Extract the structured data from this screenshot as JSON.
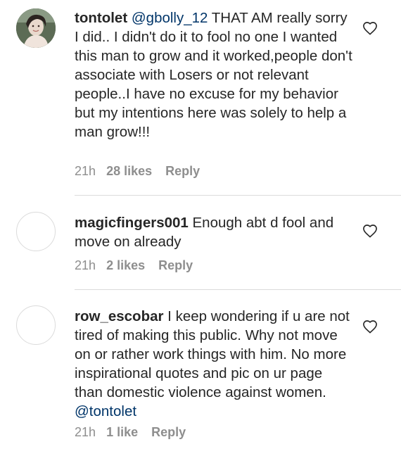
{
  "comments": [
    {
      "username": "tontolet",
      "mention": "@gbolly_12",
      "text": " THAT AM really sorry I did.. I didn't do it to fool no one I wanted this man to grow and it worked,people don't associate with Losers or not relevant people..I have no excuse for my behavior but my intentions here was solely to help a man grow!!!",
      "time": "21h",
      "likes": "28 likes",
      "reply": "Reply",
      "avatar": "profile-photo"
    },
    {
      "username": "magicfingers001",
      "text": " Enough abt d fool and move on already",
      "time": "21h",
      "likes": "2 likes",
      "reply": "Reply",
      "avatar": "empty"
    },
    {
      "username": "row_escobar",
      "text": " I keep wondering if u are not tired of making this public.  Why not move on or rather work things with him. No more inspirational quotes and pic on  ur page than domestic violence against  women. ",
      "mention": "@tontolet",
      "time": "21h",
      "likes": "1 like",
      "reply": "Reply",
      "avatar": "empty"
    }
  ],
  "colors": {
    "text": "#262626",
    "meta": "#8e8e8e",
    "mention": "#003569",
    "divider": "#dbdbdb"
  },
  "icons": {
    "like": "heart-outline-icon"
  }
}
